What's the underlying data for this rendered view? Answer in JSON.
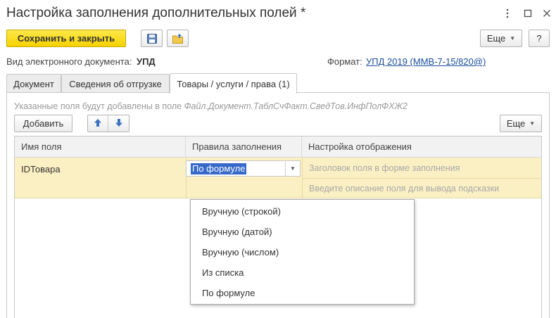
{
  "window": {
    "title": "Настройка заполнения дополнительных полей *",
    "menu_icon": "kebab-menu-icon",
    "maximize_icon": "maximize-icon",
    "close_icon": "close-icon"
  },
  "toolbar": {
    "save_close_label": "Сохранить и закрыть",
    "more_label": "Еще",
    "help_label": "?"
  },
  "document": {
    "type_label": "Вид электронного документа:",
    "type_value": "УПД",
    "format_label": "Формат:",
    "format_value": "УПД 2019 (ММВ-7-15/820@)"
  },
  "tabs": [
    {
      "label": "Документ",
      "active": false
    },
    {
      "label": "Сведения об отгрузке",
      "active": false
    },
    {
      "label": "Товары / услуги / права (1)",
      "active": true
    }
  ],
  "panel": {
    "hint_prefix": "Указанные поля будут добавлены в поле ",
    "hint_path": "Файл.Документ.ТаблСчФакт.СведТов.ИнфПолФХЖ2",
    "add_label": "Добавить",
    "more_label": "Еще"
  },
  "grid": {
    "columns": [
      "Имя поля",
      "Правила заполнения",
      "Настройка отображения"
    ],
    "rows": [
      {
        "field_name": "IDТовара",
        "rule": "По формуле",
        "title_placeholder": "Заголовок поля в форме заполнения",
        "hint_placeholder": "Введите описание поля для вывода подсказки"
      }
    ]
  },
  "dropdown": {
    "options": [
      "Вручную (строкой)",
      "Вручную (датой)",
      "Вручную (числом)",
      "Из списка",
      "По формуле"
    ]
  },
  "colors": {
    "primary_button": "#f5d200",
    "selected_row": "#fbf0c4",
    "link": "#1a4f9c",
    "selection": "#3568c9"
  }
}
